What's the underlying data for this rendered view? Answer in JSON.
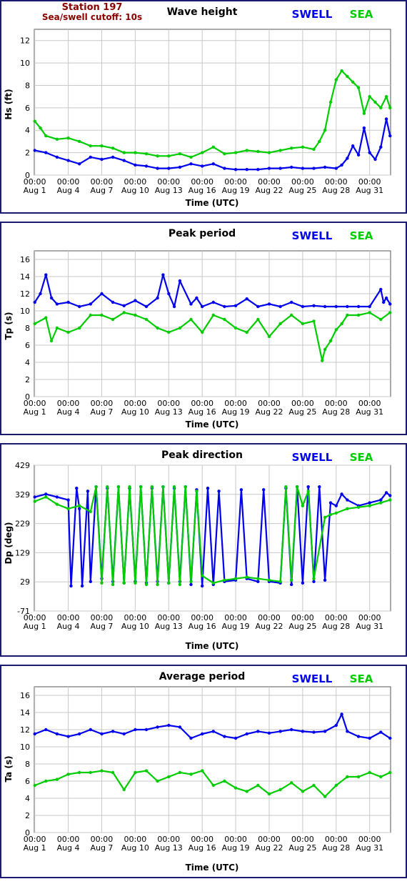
{
  "station": {
    "title": "Station 197",
    "cutoff": "Sea/swell cutoff: 10s"
  },
  "colors": {
    "swell": "#0000ee",
    "sea": "#00cc00",
    "frame": "#1a1a6e",
    "station": "#880000",
    "grid": "#c8c8c8"
  },
  "legend": {
    "swell": "SWELL",
    "sea": "SEA"
  },
  "x_axis": {
    "label": "Time (UTC)",
    "start": "2024-07-31T23:00Z",
    "end": "2024-09-01T21:00Z",
    "ticks": [
      {
        "t": "2024-08-01T00:00Z",
        "time": "00:00",
        "date": "Aug 1"
      },
      {
        "t": "2024-08-04T00:00Z",
        "time": "00:00",
        "date": "Aug 4"
      },
      {
        "t": "2024-08-07T00:00Z",
        "time": "00:00",
        "date": "Aug 7"
      },
      {
        "t": "2024-08-10T00:00Z",
        "time": "00:00",
        "date": "Aug 10"
      },
      {
        "t": "2024-08-13T00:00Z",
        "time": "00:00",
        "date": "Aug 13"
      },
      {
        "t": "2024-08-16T00:00Z",
        "time": "00:00",
        "date": "Aug 16"
      },
      {
        "t": "2024-08-19T00:00Z",
        "time": "00:00",
        "date": "Aug 19"
      },
      {
        "t": "2024-08-22T00:00Z",
        "time": "00:00",
        "date": "Aug 22"
      },
      {
        "t": "2024-08-25T00:00Z",
        "time": "00:00",
        "date": "Aug 25"
      },
      {
        "t": "2024-08-28T00:00Z",
        "time": "00:00",
        "date": "Aug 28"
      },
      {
        "t": "2024-08-31T00:00Z",
        "time": "00:00",
        "date": "Aug 31"
      }
    ]
  },
  "chart_data": [
    {
      "type": "line",
      "title": "Wave height",
      "ylabel": "Hs (ft)",
      "xlabel": "Time (UTC)",
      "ylim": [
        0,
        13
      ],
      "yticks": [
        0,
        2,
        4,
        6,
        8,
        10,
        12
      ],
      "grid": true,
      "legend": "top-right",
      "series": [
        {
          "name": "SWELL",
          "x": [
            "2024-08-01",
            "2024-08-02",
            "2024-08-03",
            "2024-08-04",
            "2024-08-05",
            "2024-08-06",
            "2024-08-07",
            "2024-08-08",
            "2024-08-09",
            "2024-08-10",
            "2024-08-11",
            "2024-08-12",
            "2024-08-13",
            "2024-08-14",
            "2024-08-15",
            "2024-08-16",
            "2024-08-17",
            "2024-08-18",
            "2024-08-19",
            "2024-08-20",
            "2024-08-21",
            "2024-08-22",
            "2024-08-23",
            "2024-08-24",
            "2024-08-25",
            "2024-08-26",
            "2024-08-27",
            "2024-08-28",
            "2024-08-28T12:00Z",
            "2024-08-29",
            "2024-08-29T12:00Z",
            "2024-08-30",
            "2024-08-30T12:00Z",
            "2024-08-31",
            "2024-08-31T12:00Z",
            "2024-09-01",
            "2024-09-01T12:00Z",
            "2024-09-01T20:00Z"
          ],
          "y": [
            2.2,
            2.0,
            1.6,
            1.3,
            1.0,
            1.6,
            1.4,
            1.6,
            1.3,
            0.9,
            0.8,
            0.6,
            0.6,
            0.7,
            1.0,
            0.8,
            1.0,
            0.6,
            0.5,
            0.5,
            0.5,
            0.6,
            0.6,
            0.7,
            0.6,
            0.6,
            0.7,
            0.6,
            0.9,
            1.5,
            2.6,
            1.8,
            4.2,
            2.0,
            1.4,
            2.5,
            5.0,
            3.5
          ]
        },
        {
          "name": "SEA",
          "x": [
            "2024-08-01",
            "2024-08-01T12:00Z",
            "2024-08-02",
            "2024-08-03",
            "2024-08-04",
            "2024-08-05",
            "2024-08-06",
            "2024-08-07",
            "2024-08-08",
            "2024-08-09",
            "2024-08-10",
            "2024-08-11",
            "2024-08-12",
            "2024-08-13",
            "2024-08-14",
            "2024-08-15",
            "2024-08-16",
            "2024-08-17",
            "2024-08-18",
            "2024-08-19",
            "2024-08-20",
            "2024-08-21",
            "2024-08-22",
            "2024-08-23",
            "2024-08-24",
            "2024-08-25",
            "2024-08-26",
            "2024-08-26T12:00Z",
            "2024-08-27",
            "2024-08-27T12:00Z",
            "2024-08-28",
            "2024-08-28T12:00Z",
            "2024-08-29",
            "2024-08-29T12:00Z",
            "2024-08-30",
            "2024-08-30T12:00Z",
            "2024-08-31",
            "2024-08-31T12:00Z",
            "2024-09-01",
            "2024-09-01T12:00Z",
            "2024-09-01T20:00Z"
          ],
          "y": [
            4.8,
            4.2,
            3.5,
            3.2,
            3.3,
            3.0,
            2.6,
            2.6,
            2.4,
            2.0,
            2.0,
            1.9,
            1.7,
            1.7,
            1.9,
            1.6,
            2.0,
            2.5,
            1.9,
            2.0,
            2.2,
            2.1,
            2.0,
            2.2,
            2.4,
            2.5,
            2.3,
            3.0,
            4.0,
            6.5,
            8.5,
            9.3,
            8.8,
            8.3,
            7.8,
            5.5,
            7.0,
            6.5,
            6.0,
            7.0,
            6.0
          ]
        }
      ]
    },
    {
      "type": "line",
      "title": "Peak period",
      "ylabel": "Tp (s)",
      "xlabel": "Time (UTC)",
      "ylim": [
        0,
        17
      ],
      "yticks": [
        0,
        2,
        4,
        6,
        8,
        10,
        12,
        14,
        16
      ],
      "grid": true,
      "legend": "top-right",
      "series": [
        {
          "name": "SWELL",
          "x": [
            "2024-08-01",
            "2024-08-01T12:00Z",
            "2024-08-02",
            "2024-08-02T12:00Z",
            "2024-08-03",
            "2024-08-04",
            "2024-08-05",
            "2024-08-06",
            "2024-08-07",
            "2024-08-08",
            "2024-08-09",
            "2024-08-10",
            "2024-08-11",
            "2024-08-12",
            "2024-08-12T12:00Z",
            "2024-08-13",
            "2024-08-13T12:00Z",
            "2024-08-14",
            "2024-08-15",
            "2024-08-15T12:00Z",
            "2024-08-16",
            "2024-08-17",
            "2024-08-18",
            "2024-08-19",
            "2024-08-20",
            "2024-08-21",
            "2024-08-22",
            "2024-08-23",
            "2024-08-24",
            "2024-08-25",
            "2024-08-26",
            "2024-08-27",
            "2024-08-28",
            "2024-08-29",
            "2024-08-30",
            "2024-08-31",
            "2024-09-01",
            "2024-09-01T06:00Z",
            "2024-09-01T12:00Z",
            "2024-09-01T20:00Z"
          ],
          "y": [
            11.0,
            12.0,
            14.2,
            11.5,
            10.8,
            11.0,
            10.5,
            10.8,
            12.0,
            11.0,
            10.6,
            11.2,
            10.5,
            11.5,
            14.2,
            12.0,
            10.5,
            13.5,
            10.8,
            11.5,
            10.5,
            11.0,
            10.5,
            10.6,
            11.4,
            10.5,
            10.8,
            10.5,
            11.0,
            10.5,
            10.6,
            10.5,
            10.5,
            10.5,
            10.5,
            10.5,
            12.5,
            11.0,
            11.5,
            10.8
          ]
        },
        {
          "name": "SEA",
          "x": [
            "2024-08-01",
            "2024-08-02",
            "2024-08-02T12:00Z",
            "2024-08-03",
            "2024-08-04",
            "2024-08-05",
            "2024-08-06",
            "2024-08-07",
            "2024-08-08",
            "2024-08-09",
            "2024-08-10",
            "2024-08-11",
            "2024-08-12",
            "2024-08-13",
            "2024-08-14",
            "2024-08-15",
            "2024-08-16",
            "2024-08-17",
            "2024-08-18",
            "2024-08-19",
            "2024-08-20",
            "2024-08-21",
            "2024-08-22",
            "2024-08-23",
            "2024-08-24",
            "2024-08-25",
            "2024-08-26",
            "2024-08-26T18:00Z",
            "2024-08-27",
            "2024-08-27T12:00Z",
            "2024-08-28",
            "2024-08-28T12:00Z",
            "2024-08-29",
            "2024-08-30",
            "2024-08-31",
            "2024-09-01",
            "2024-09-01T20:00Z"
          ],
          "y": [
            8.5,
            9.2,
            6.5,
            8.0,
            7.5,
            8.0,
            9.5,
            9.5,
            9.0,
            9.8,
            9.5,
            9.0,
            8.0,
            7.5,
            8.0,
            9.0,
            7.5,
            9.5,
            9.0,
            8.0,
            7.5,
            9.0,
            7.0,
            8.5,
            9.5,
            8.5,
            8.8,
            4.2,
            5.5,
            6.5,
            7.8,
            8.5,
            9.5,
            9.5,
            9.8,
            9.0,
            9.8
          ]
        }
      ]
    },
    {
      "type": "line",
      "title": "Peak direction",
      "ylabel": "Dp (deg)",
      "xlabel": "Time (UTC)",
      "ylim": [
        -71,
        429
      ],
      "yticks": [
        -71,
        29,
        129,
        229,
        329,
        429
      ],
      "grid": true,
      "legend": "top-right",
      "series": [
        {
          "name": "SWELL",
          "x": [
            "2024-08-01",
            "2024-08-02",
            "2024-08-03",
            "2024-08-04",
            "2024-08-04T06:00Z",
            "2024-08-04T18:00Z",
            "2024-08-05",
            "2024-08-05T06:00Z",
            "2024-08-05T18:00Z",
            "2024-08-06",
            "2024-08-06T12:00Z",
            "2024-08-07",
            "2024-08-07T12:00Z",
            "2024-08-08",
            "2024-08-08T12:00Z",
            "2024-08-09",
            "2024-08-09T12:00Z",
            "2024-08-10",
            "2024-08-10T12:00Z",
            "2024-08-11",
            "2024-08-11T12:00Z",
            "2024-08-12",
            "2024-08-12T12:00Z",
            "2024-08-13",
            "2024-08-13T12:00Z",
            "2024-08-14",
            "2024-08-14T12:00Z",
            "2024-08-15",
            "2024-08-15T12:00Z",
            "2024-08-16",
            "2024-08-16T12:00Z",
            "2024-08-17",
            "2024-08-17T12:00Z",
            "2024-08-18",
            "2024-08-19",
            "2024-08-19T12:00Z",
            "2024-08-20",
            "2024-08-21",
            "2024-08-21T12:00Z",
            "2024-08-22",
            "2024-08-23",
            "2024-08-23T12:00Z",
            "2024-08-24",
            "2024-08-24T12:00Z",
            "2024-08-25",
            "2024-08-25T12:00Z",
            "2024-08-26",
            "2024-08-26T12:00Z",
            "2024-08-27",
            "2024-08-27T12:00Z",
            "2024-08-28",
            "2024-08-28T12:00Z",
            "2024-08-29",
            "2024-08-30",
            "2024-08-31",
            "2024-09-01",
            "2024-09-01T12:00Z",
            "2024-09-01T20:00Z"
          ],
          "y": [
            320,
            330,
            320,
            310,
            15,
            350,
            280,
            15,
            340,
            30,
            355,
            40,
            350,
            30,
            355,
            25,
            350,
            30,
            355,
            25,
            350,
            30,
            355,
            25,
            350,
            30,
            355,
            20,
            345,
            15,
            350,
            20,
            340,
            30,
            35,
            345,
            40,
            30,
            345,
            30,
            25,
            350,
            20,
            355,
            25,
            355,
            30,
            355,
            35,
            300,
            290,
            330,
            310,
            290,
            300,
            310,
            335,
            325
          ]
        },
        {
          "name": "SEA",
          "x": [
            "2024-08-01",
            "2024-08-02",
            "2024-08-03",
            "2024-08-04",
            "2024-08-05",
            "2024-08-06",
            "2024-08-06T12:00Z",
            "2024-08-07",
            "2024-08-07T12:00Z",
            "2024-08-08",
            "2024-08-08T12:00Z",
            "2024-08-09",
            "2024-08-09T12:00Z",
            "2024-08-10",
            "2024-08-10T12:00Z",
            "2024-08-11",
            "2024-08-11T12:00Z",
            "2024-08-12",
            "2024-08-12T12:00Z",
            "2024-08-13",
            "2024-08-13T12:00Z",
            "2024-08-14",
            "2024-08-14T12:00Z",
            "2024-08-15",
            "2024-08-15T12:00Z",
            "2024-08-16",
            "2024-08-17",
            "2024-08-18",
            "2024-08-19",
            "2024-08-20",
            "2024-08-21",
            "2024-08-22",
            "2024-08-23",
            "2024-08-23T12:00Z",
            "2024-08-24",
            "2024-08-24T12:00Z",
            "2024-08-25",
            "2024-08-25T12:00Z",
            "2024-08-26",
            "2024-08-27",
            "2024-08-27T12:00Z",
            "2024-08-28",
            "2024-08-29",
            "2024-08-30",
            "2024-08-31",
            "2024-09-01",
            "2024-09-01T20:00Z"
          ],
          "y": [
            305,
            320,
            295,
            280,
            290,
            270,
            355,
            25,
            355,
            20,
            355,
            25,
            355,
            25,
            355,
            20,
            355,
            20,
            355,
            25,
            355,
            20,
            355,
            30,
            340,
            50,
            25,
            35,
            40,
            45,
            40,
            35,
            30,
            355,
            35,
            355,
            290,
            340,
            40,
            250,
            260,
            265,
            280,
            285,
            290,
            300,
            310
          ]
        }
      ]
    },
    {
      "type": "line",
      "title": "Average period",
      "ylabel": "Ta (s)",
      "xlabel": "Time (UTC)",
      "ylim": [
        0,
        17
      ],
      "yticks": [
        0,
        2,
        4,
        6,
        8,
        10,
        12,
        14,
        16
      ],
      "grid": true,
      "legend": "top-right",
      "series": [
        {
          "name": "SWELL",
          "x": [
            "2024-08-01",
            "2024-08-02",
            "2024-08-03",
            "2024-08-04",
            "2024-08-05",
            "2024-08-06",
            "2024-08-07",
            "2024-08-08",
            "2024-08-09",
            "2024-08-10",
            "2024-08-11",
            "2024-08-12",
            "2024-08-13",
            "2024-08-14",
            "2024-08-15",
            "2024-08-16",
            "2024-08-17",
            "2024-08-18",
            "2024-08-19",
            "2024-08-20",
            "2024-08-21",
            "2024-08-22",
            "2024-08-23",
            "2024-08-24",
            "2024-08-25",
            "2024-08-26",
            "2024-08-27",
            "2024-08-28",
            "2024-08-28T12:00Z",
            "2024-08-29",
            "2024-08-30",
            "2024-08-31",
            "2024-09-01",
            "2024-09-01T20:00Z"
          ],
          "y": [
            11.5,
            12.0,
            11.5,
            11.2,
            11.5,
            12.0,
            11.5,
            11.8,
            11.5,
            12.0,
            12.0,
            12.3,
            12.5,
            12.3,
            11.0,
            11.5,
            11.8,
            11.2,
            11.0,
            11.5,
            11.8,
            11.6,
            11.8,
            12.0,
            11.8,
            11.7,
            11.8,
            12.5,
            13.8,
            11.8,
            11.2,
            11.0,
            11.7,
            11.0
          ]
        },
        {
          "name": "SEA",
          "x": [
            "2024-08-01",
            "2024-08-02",
            "2024-08-03",
            "2024-08-04",
            "2024-08-05",
            "2024-08-06",
            "2024-08-07",
            "2024-08-08",
            "2024-08-09",
            "2024-08-10",
            "2024-08-11",
            "2024-08-12",
            "2024-08-13",
            "2024-08-14",
            "2024-08-15",
            "2024-08-16",
            "2024-08-17",
            "2024-08-18",
            "2024-08-19",
            "2024-08-20",
            "2024-08-21",
            "2024-08-22",
            "2024-08-23",
            "2024-08-24",
            "2024-08-25",
            "2024-08-26",
            "2024-08-27",
            "2024-08-28",
            "2024-08-29",
            "2024-08-30",
            "2024-08-31",
            "2024-09-01",
            "2024-09-01T20:00Z"
          ],
          "y": [
            5.5,
            6.0,
            6.2,
            6.8,
            7.0,
            7.0,
            7.2,
            7.0,
            5.0,
            7.0,
            7.2,
            6.0,
            6.5,
            7.0,
            6.8,
            7.2,
            5.5,
            6.0,
            5.2,
            4.8,
            5.5,
            4.5,
            5.0,
            5.8,
            4.8,
            5.5,
            4.2,
            5.5,
            6.5,
            6.5,
            7.0,
            6.5,
            7.0
          ]
        }
      ]
    }
  ]
}
